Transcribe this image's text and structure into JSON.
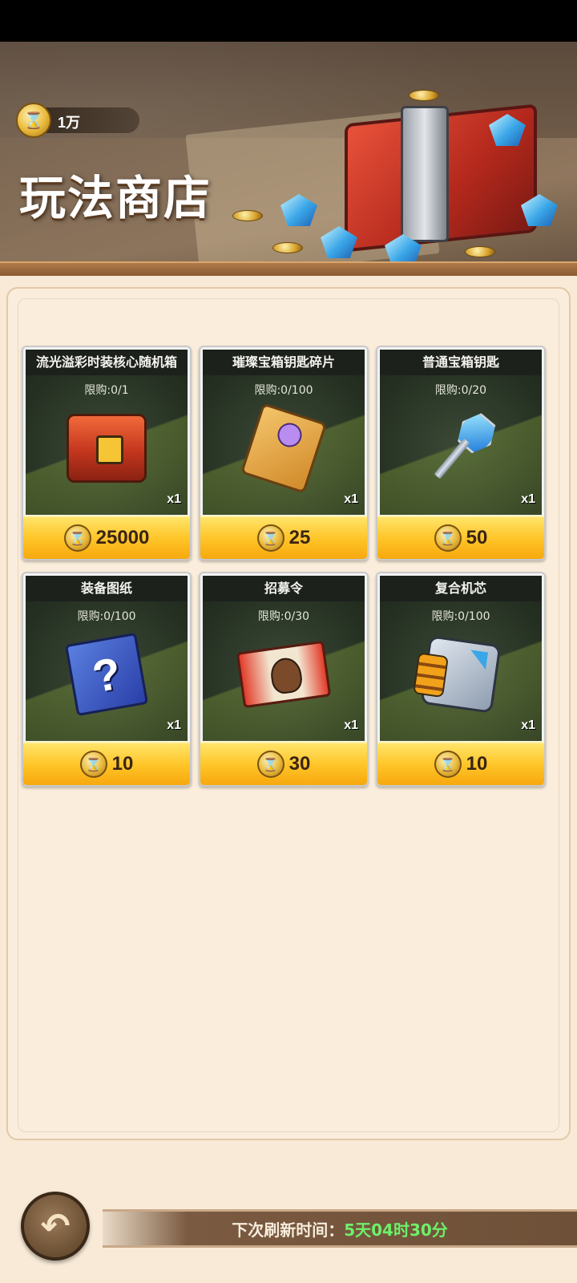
{
  "header": {
    "currency_amount": "1万",
    "currency_icon": "hourglass-coin-icon",
    "title": "玩法商店"
  },
  "items": [
    {
      "name": "流光溢彩时装核心随机箱",
      "limit": "限购:0/1",
      "qty": "x1",
      "price": "25000",
      "icon": "red-chest-icon"
    },
    {
      "name": "璀璨宝箱钥匙碎片",
      "limit": "限购:0/100",
      "qty": "x1",
      "price": "25",
      "icon": "key-fragment-icon"
    },
    {
      "name": "普通宝箱钥匙",
      "limit": "限购:0/20",
      "qty": "x1",
      "price": "50",
      "icon": "blue-key-icon"
    },
    {
      "name": "装备图纸",
      "limit": "限购:0/100",
      "qty": "x1",
      "price": "10",
      "icon": "blueprint-question-icon"
    },
    {
      "name": "招募令",
      "limit": "限购:0/30",
      "qty": "x1",
      "price": "30",
      "icon": "recruit-ticket-icon"
    },
    {
      "name": "复合机芯",
      "limit": "限购:0/100",
      "qty": "x1",
      "price": "10",
      "icon": "core-chip-icon"
    }
  ],
  "footer": {
    "refresh_label": "下次刷新时间：",
    "refresh_time": "5天04时30分",
    "back_icon": "back-arrow-icon"
  },
  "colors": {
    "price_button": "#ffc62a",
    "refresh_time": "#6ef06a",
    "panel_background": "#faeddc"
  }
}
